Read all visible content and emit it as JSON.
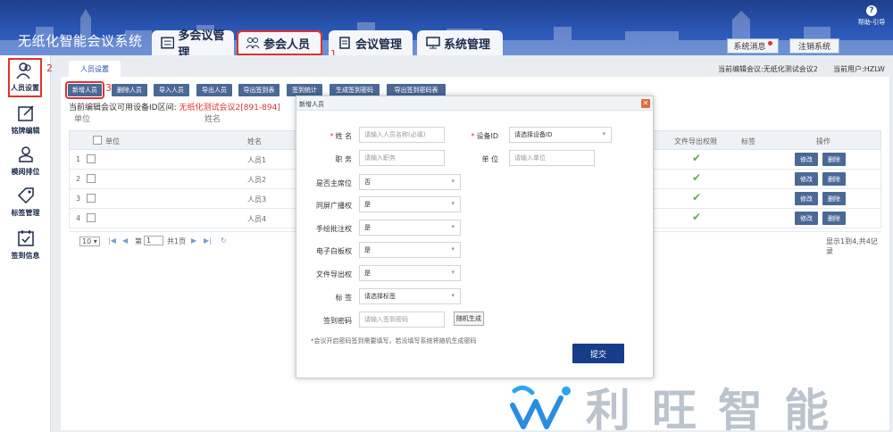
{
  "header": {
    "app_title": "无纸化智能会议系统",
    "nav_tabs": [
      {
        "label": "多会议管理",
        "icon": "list-icon"
      },
      {
        "label": "参会人员",
        "icon": "people-icon",
        "active": true
      },
      {
        "label": "会议管理",
        "icon": "document-icon"
      },
      {
        "label": "系统管理",
        "icon": "monitor-icon"
      }
    ],
    "system_message": "系统消息",
    "logout": "注销系统",
    "help": "帮助-引导"
  },
  "annotations": {
    "one": "1",
    "two": "2",
    "three": "3"
  },
  "sidebar": {
    "items": [
      {
        "label": "人员设置",
        "icon": "person-icon",
        "active": true
      },
      {
        "label": "铭牌编辑",
        "icon": "edit-icon"
      },
      {
        "label": "模阅排位",
        "icon": "seat-person-icon"
      },
      {
        "label": "标签管理",
        "icon": "tag-icon"
      },
      {
        "label": "签到信息",
        "icon": "calendar-check-icon"
      }
    ]
  },
  "main": {
    "sub_tab": "人员设置",
    "current_meeting": "当前编辑会议:无纸化测试会议2",
    "current_user": "当前用户:HZLW",
    "toolbar": [
      "新增人员",
      "删除人员",
      "导入人员",
      "导出人员",
      "导出签到表",
      "签到统计",
      "生成签到密码",
      "导出签到密码表"
    ],
    "device_note": "当前编辑会议可用设备ID区间:",
    "device_range": "无纸化测试会议2[891-894]",
    "filters": [
      "单位",
      "姓名"
    ],
    "table": {
      "headers": {
        "unit": "单位",
        "name": "姓名",
        "file_export": "文件导出权限",
        "tag": "标签",
        "ops": "操作"
      },
      "rows": [
        {
          "index": "1",
          "name": "人员1"
        },
        {
          "index": "2",
          "name": "人员2"
        },
        {
          "index": "3",
          "name": "人员3"
        },
        {
          "index": "4",
          "name": "人员4"
        }
      ],
      "edit_label": "修改",
      "delete_label": "删除"
    },
    "pager": {
      "page_size": "10",
      "page_prefix": "第",
      "page_value": "1",
      "page_suffix": "共1页",
      "summary": "显示1到4,共4记录"
    }
  },
  "modal": {
    "title": "新增人员",
    "fields": {
      "name_label": "姓  名",
      "name_placeholder": "请输入人员名称(必填)",
      "device_label": "设备ID",
      "device_value": "请选择设备ID",
      "position_label": "职  务",
      "position_placeholder": "请输入职务",
      "unit_label": "单  位",
      "unit_placeholder": "请输入单位",
      "chair_label": "是否主席位",
      "chair_value": "否",
      "broadcast_label": "同屏广播权",
      "broadcast_value": "是",
      "annotate_label": "手绘批注权",
      "annotate_value": "是",
      "whiteboard_label": "电子白板权",
      "whiteboard_value": "是",
      "export_label": "文件导出权",
      "export_value": "是",
      "tag_label": "标  签",
      "tag_value": "请选择标签",
      "password_label": "签到密码",
      "password_placeholder": "请输入签到密码",
      "random_button": "随机生成"
    },
    "hint": "*会议开启密码签到需要填写，若没填写系统将随机生成密码",
    "submit": "提交"
  },
  "watermark": {
    "text": "利旺智能",
    "icon": "company-logo-icon"
  },
  "colors": {
    "header": "#2b57b6",
    "button": "#4b6896",
    "accent_red": "#e0312f",
    "submit": "#173d8a"
  }
}
